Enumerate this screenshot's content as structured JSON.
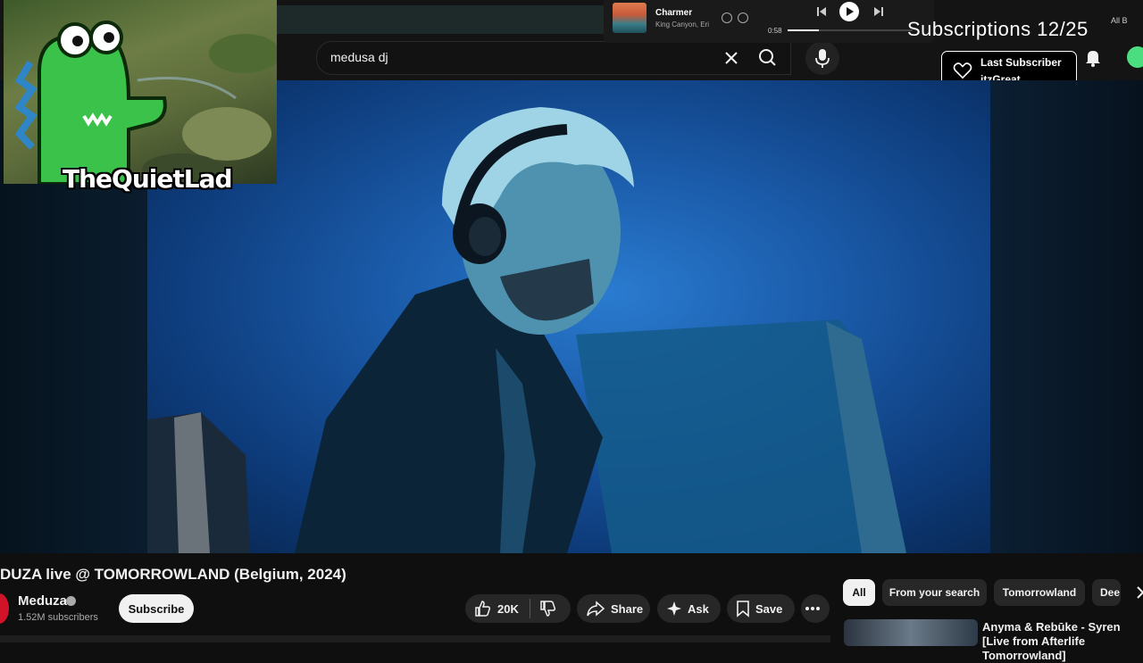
{
  "search": {
    "query": "medusa dj"
  },
  "music_widget": {
    "track_title": "Charmer",
    "track_artist": "King Canyon, Eri",
    "elapsed": "0:58",
    "progress": 0.25
  },
  "overlay": {
    "subscriptions_counter": "Subscriptions 12/25",
    "folder_label": "All B",
    "last_subscriber_title": "Last Subscriber",
    "last_subscriber_name": "itzGreat",
    "streamer_tag": "TheQuietLad"
  },
  "video": {
    "title": "DUZA live @ TOMORROWLAND (Belgium, 2024)",
    "channel_name": "Meduza",
    "channel_subscribers": "1.52M subscribers",
    "subscribe_label": "Subscribe",
    "like_count": "20K",
    "share_label": "Share",
    "ask_label": "Ask",
    "save_label": "Save"
  },
  "chips": [
    "All",
    "From your search",
    "Tomorrowland",
    "Dee"
  ],
  "recommendation": {
    "title": "Anyma & Rebūke - Syren [Live from Afterlife Tomorrowland]"
  },
  "colors": {
    "background": "#0f0f0f",
    "chip_active": "#f1f1f1",
    "accent_red": "#d1132a",
    "video_blue": "#1a5aa8"
  }
}
